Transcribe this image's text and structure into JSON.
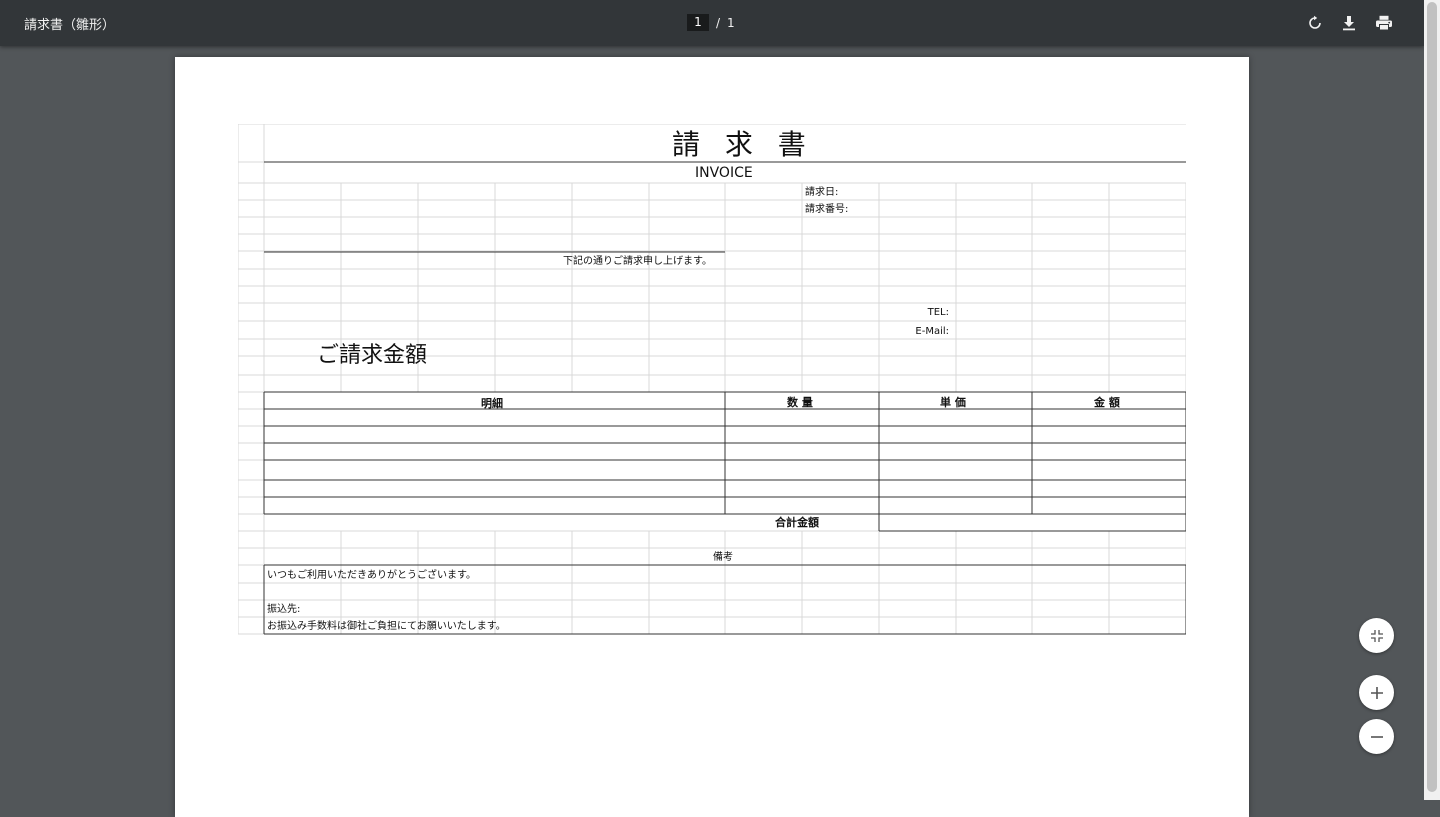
{
  "viewer": {
    "title": "請求書（雛形）",
    "current_page": "1",
    "page_separator": "/",
    "total_pages": "1"
  },
  "toolbar": {
    "icons": [
      "rotate-icon",
      "download-icon",
      "print-icon"
    ]
  },
  "zoom_controls": {
    "icons": [
      "fit-page-icon",
      "zoom-in-icon",
      "zoom-out-icon"
    ]
  },
  "invoice": {
    "title": "請 求 書",
    "subtitle": "INVOICE",
    "invoice_date_label": "請求日:",
    "invoice_number_label": "請求番号:",
    "intro_text": "下記の通りご請求申し上げます。",
    "tel_label": "TEL:",
    "email_label": "E-Mail:",
    "amount_label": "ご請求金額",
    "table_headers": {
      "description": "明細",
      "quantity": "数 量",
      "unit_price": "単 価",
      "amount": "金 額"
    },
    "total_label": "合計金額",
    "remarks_label": "備考",
    "remarks_lines": [
      "いつもご利用いただきありがとうございます。",
      "",
      "振込先:",
      "お振込み手数料は御社ご負担にてお願いいたします。"
    ]
  },
  "colors": {
    "viewer_background": "#525659",
    "toolbar_background": "#323639",
    "page_background": "#ffffff",
    "grid_line": "#d9d9d9",
    "border_line": "#333333"
  }
}
